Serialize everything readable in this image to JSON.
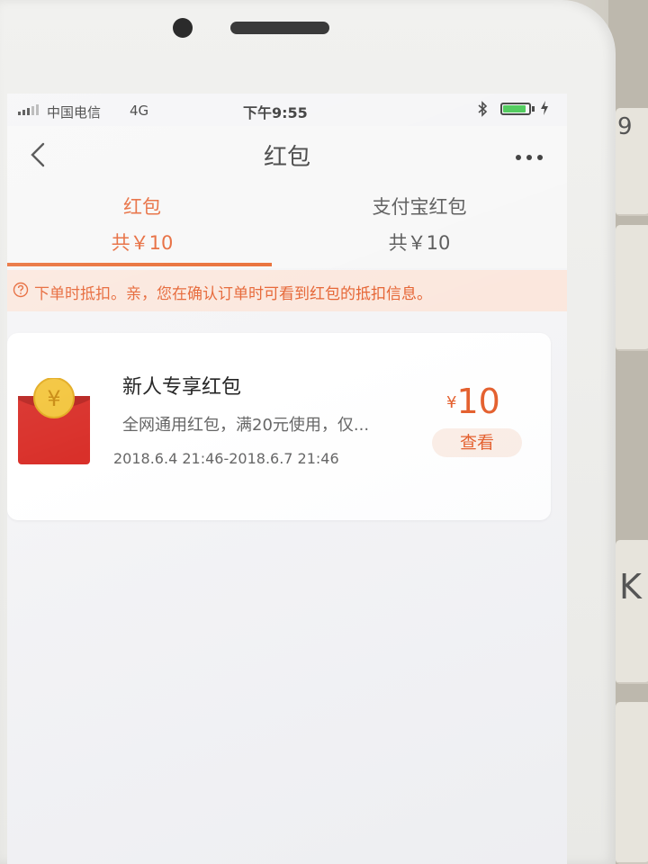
{
  "status_bar": {
    "carrier": "中国电信",
    "network": "4G",
    "time": "下午9:55",
    "battery_level": 0.9
  },
  "nav": {
    "title": "红包"
  },
  "tabs": [
    {
      "label": "红包",
      "total": "共￥10",
      "active": true
    },
    {
      "label": "支付宝红包",
      "total": "共￥10",
      "active": false
    }
  ],
  "notice": {
    "text": "下单时抵扣。亲，您在确认订单时可看到红包的抵扣信息。"
  },
  "coupon": {
    "title": "新人专享红包",
    "description": "全网通用红包，满20元使用，仅...",
    "validity": "2018.6.4 21:46-2018.6.7 21:46",
    "currency_symbol": "¥",
    "amount": "10",
    "view_label": "查看",
    "envelope_coin_symbol": "¥"
  },
  "background_keys": [
    "9",
    "K"
  ],
  "colors": {
    "accent": "#e5602e",
    "notice_bg": "#fbe7dd",
    "envelope_red": "#d9302a",
    "coin_gold": "#f3c53d"
  }
}
